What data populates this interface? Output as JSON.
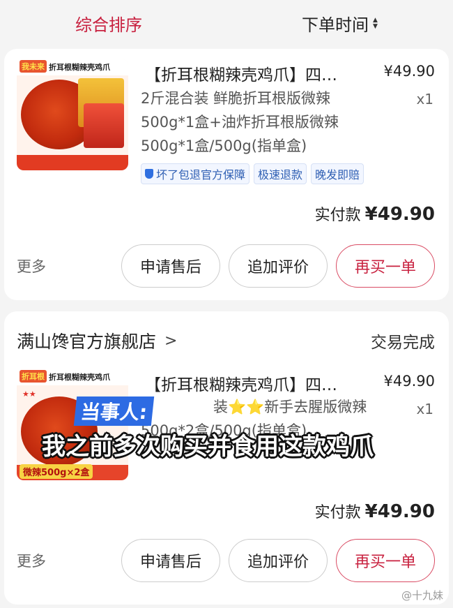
{
  "sort_bar": {
    "left_label": "综合排序",
    "right_label": "下单时间",
    "sort_icon": "sort-updown-icon"
  },
  "orders": [
    {
      "thumb": {
        "badge": "我未来",
        "title": "折耳根糊辣壳鸡爪"
      },
      "title": "【折耳根糊辣壳鸡爪】四…",
      "price": "¥49.90",
      "spec": "2斤混合装 鲜脆折耳根版微辣500g*1盒+油炸折耳根版微辣500g*1盒/500g(指单盒)",
      "qty": "x1",
      "tags": [
        "坏了包退官方保障",
        "极速退款",
        "晚发即赔"
      ],
      "paid_label": "实付款",
      "paid_amount": "¥49.90",
      "more": "更多",
      "buttons": [
        "申请售后",
        "追加评价",
        "再买一单"
      ]
    },
    {
      "shop_name": "满山馋官方旗舰店",
      "status": "交易完成",
      "thumb": {
        "badge": "折耳根",
        "title": "折耳根糊辣壳鸡爪",
        "caption": "微辣500g×2盒"
      },
      "title": "【折耳根糊辣壳鸡爪】四…",
      "price": "¥49.90",
      "spec_visible": "装⭐⭐新手去腥版微辣",
      "spec_line2": "500g*2盒/500g(指单盒)",
      "qty": "x1",
      "paid_label": "实付款",
      "paid_amount": "¥49.90",
      "more": "更多",
      "buttons": [
        "申请售后",
        "追加评价",
        "再买一单"
      ]
    }
  ],
  "overlay": {
    "speaker": "当事人:",
    "subtitle": "我之前多次购买并食用这款鸡爪"
  },
  "watermark": "@十九妹",
  "colors": {
    "accent": "#c8213f",
    "tag_blue": "#2f5fb3"
  }
}
